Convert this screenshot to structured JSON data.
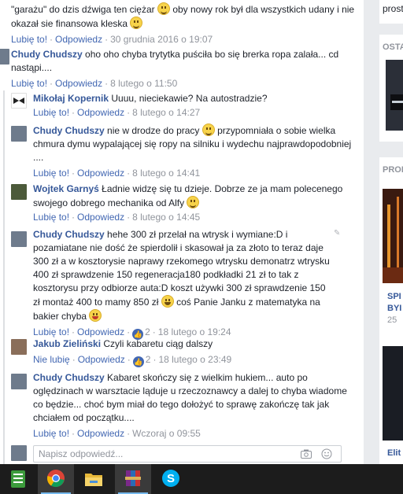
{
  "actions": {
    "like": "Lubię to!",
    "unlike": "Nie lubię",
    "reply": "Odpowiedz",
    "sep": "·"
  },
  "comments": [
    {
      "text_a": "\"garażu\" do dzis dźwiga ten ciężar",
      "text_b": "oby nowy rok był dla wszystkich udany i nie okazał sie finansowa kleska",
      "time": "30 grudnia 2016 o 19:07"
    },
    {
      "author": "Chudy Chudszy",
      "text": "oho oho chyba trytytka puściła bo się brerka ropa zalała... cd nastąpi....",
      "time": "8 lutego o 11:50"
    }
  ],
  "replies": [
    {
      "author": "Mikołaj Kopernik",
      "text": "Uuuu, nieciekawie? Na autostradzie?",
      "time": "8 lutego o 14:27"
    },
    {
      "author": "Chudy Chudszy",
      "text_a": "nie w drodze do pracy",
      "text_b": "przypomniała o sobie wielka chmura dymu wypalającej się ropy na silniku i wydechu najprawdopodobniej ....",
      "time": "8 lutego o 14:41"
    },
    {
      "author": "Wojtek Garnyś",
      "text": "Ładnie widzę się tu dzieje. Dobrze ze ja mam polecenego swojego dobrego mechanika od Alfy",
      "time": "8 lutego o 14:45"
    },
    {
      "author": "Chudy Chudszy",
      "text_a": "hehe 300 zł przelał na wtrysk i wymiane:D i pozamiatane nie dość że spierdolił i skasował ja za złoto to teraz daje 300 zł a w kosztorysie naprawy rzekomego wtrysku demonatrz wtrysku 400 zł sprawdzenie 150 regeneracja180 podkładki 21 zł to tak z kosztorysu przy odbiorze auta:D koszt używki 300 zł sprawdzenie 150 zł montaż 400 to mamy 850 zł",
      "text_b": "coś Panie Janku z matematyka na bakier chyba",
      "likes": "2",
      "time": "18 lutego o 19:24"
    },
    {
      "author": "Jakub Zieliński",
      "text": "Czyli kabaretu ciąg dalszy",
      "likes": "2",
      "time": "18 lutego o 23:49"
    },
    {
      "author": "Chudy Chudszy",
      "text": "Kabaret skończy się z wielkim hukiem... auto po oględzinach w warsztacie ląduje u rzeczoznawcy a dalej to chyba wiadome co będzie... choć bym miał do tego dołożyć to sprawę zakończę tak jak chciałem od początku....",
      "time": "Wczoraj o 09:55"
    }
  ],
  "reply_box": {
    "placeholder": "Napisz odpowiedź..."
  },
  "sidebar": {
    "top": "prost",
    "section1": "OSTA",
    "section2": "PROI",
    "card1": "SPI",
    "card2": "BYI",
    "card3": "25",
    "card4": "Elit"
  },
  "colors": {
    "link": "#365899",
    "action": "#4267b2",
    "meta": "#90949c",
    "background": "#e9ebee"
  }
}
